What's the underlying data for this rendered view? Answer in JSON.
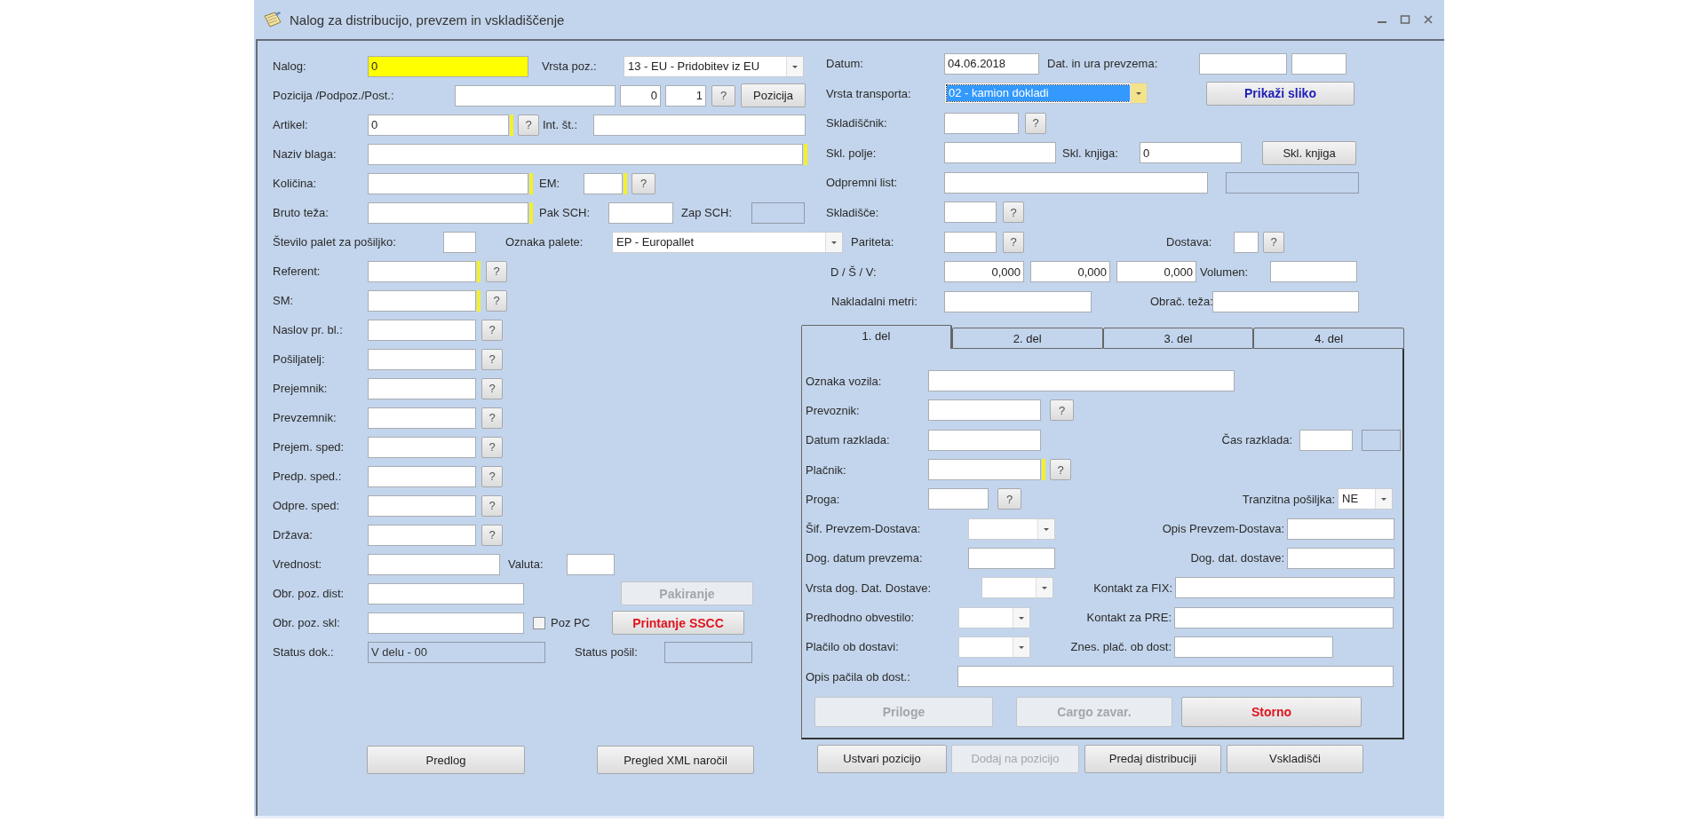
{
  "window": {
    "title": "Nalog za distribucijo, prevzem in vskladiščenje"
  },
  "left": {
    "rows": [
      {
        "items": [
          {
            "kind": "label",
            "text": "Nalog:"
          },
          {
            "kind": "field",
            "value": "0",
            "highlight": true
          },
          {
            "kind": "label",
            "text": "Vrsta poz.:"
          },
          {
            "kind": "combo",
            "value": "13 - EU - Pridobitev iz EU",
            "focused": false
          }
        ]
      },
      {
        "items": [
          {
            "kind": "label",
            "text": "Pozicija /Podpoz./Post.:"
          },
          {
            "kind": "field"
          },
          {
            "kind": "field",
            "value": "0"
          },
          {
            "kind": "field",
            "value": "1"
          },
          {
            "kind": "help",
            "text": "?"
          },
          {
            "kind": "button",
            "label": "Pozicija",
            "bold": false,
            "disabled": false
          }
        ]
      },
      {
        "items": [
          {
            "kind": "label",
            "text": "Artikel:"
          },
          {
            "kind": "field",
            "value": "0",
            "required": true
          },
          {
            "kind": "help",
            "text": "?"
          },
          {
            "kind": "label",
            "text": "Int. št.:"
          },
          {
            "kind": "field"
          }
        ]
      },
      {
        "items": [
          {
            "kind": "label",
            "text": "Naziv blaga:"
          },
          {
            "kind": "field",
            "required": true
          }
        ]
      },
      {
        "items": [
          {
            "kind": "label",
            "text": "Količina:"
          },
          {
            "kind": "field",
            "required": true
          },
          {
            "kind": "label",
            "text": "EM:"
          },
          {
            "kind": "field",
            "required": true
          },
          {
            "kind": "help",
            "text": "?"
          }
        ]
      },
      {
        "items": [
          {
            "kind": "label",
            "text": "Bruto teža:"
          },
          {
            "kind": "field",
            "required": true
          },
          {
            "kind": "label",
            "text": "Pak SCH:"
          },
          {
            "kind": "field"
          },
          {
            "kind": "label",
            "text": "Zap SCH:"
          },
          {
            "kind": "field",
            "disabled": true
          }
        ]
      },
      {
        "items": [
          {
            "kind": "label",
            "text": "Število palet za pošiljko:"
          },
          {
            "kind": "field"
          },
          {
            "kind": "label",
            "text": "Oznaka palete:"
          },
          {
            "kind": "combo",
            "value": "EP - Europallet",
            "focused": false
          }
        ]
      },
      {
        "items": [
          {
            "kind": "label",
            "text": "Referent:"
          },
          {
            "kind": "field",
            "required": true
          },
          {
            "kind": "help",
            "text": "?"
          }
        ]
      },
      {
        "items": [
          {
            "kind": "label",
            "text": "SM:"
          },
          {
            "kind": "field",
            "required": true
          },
          {
            "kind": "help",
            "text": "?"
          }
        ]
      },
      {
        "items": [
          {
            "kind": "label",
            "text": "Naslov pr. bl.:"
          },
          {
            "kind": "field"
          },
          {
            "kind": "help",
            "text": "?"
          }
        ]
      },
      {
        "items": [
          {
            "kind": "label",
            "text": "Pošiljatelj:"
          },
          {
            "kind": "field"
          },
          {
            "kind": "help",
            "text": "?"
          }
        ]
      },
      {
        "items": [
          {
            "kind": "label",
            "text": "Prejemnik:"
          },
          {
            "kind": "field"
          },
          {
            "kind": "help",
            "text": "?"
          }
        ]
      },
      {
        "items": [
          {
            "kind": "label",
            "text": "Prevzemnik:"
          },
          {
            "kind": "field"
          },
          {
            "kind": "help",
            "text": "?"
          }
        ]
      },
      {
        "items": [
          {
            "kind": "label",
            "text": "Prejem. sped:"
          },
          {
            "kind": "field"
          },
          {
            "kind": "help",
            "text": "?"
          }
        ]
      },
      {
        "items": [
          {
            "kind": "label",
            "text": "Predp. sped.:"
          },
          {
            "kind": "field"
          },
          {
            "kind": "help",
            "text": "?"
          }
        ]
      },
      {
        "items": [
          {
            "kind": "label",
            "text": "Odpre. sped:"
          },
          {
            "kind": "field"
          },
          {
            "kind": "help",
            "text": "?"
          }
        ]
      },
      {
        "items": [
          {
            "kind": "label",
            "text": "Država:"
          },
          {
            "kind": "field"
          },
          {
            "kind": "help",
            "text": "?"
          }
        ]
      },
      {
        "items": [
          {
            "kind": "label",
            "text": "Vrednost:"
          },
          {
            "kind": "field"
          },
          {
            "kind": "label",
            "text": "Valuta:"
          },
          {
            "kind": "field"
          }
        ]
      },
      {
        "items": [
          {
            "kind": "label",
            "text": "Obr. poz. dist:"
          },
          {
            "kind": "field"
          },
          {
            "kind": "button",
            "label": "Pakiranje",
            "bold": true,
            "disabled": true
          }
        ]
      },
      {
        "items": [
          {
            "kind": "label",
            "text": "Obr. poz. skl:"
          },
          {
            "kind": "field"
          },
          {
            "kind": "check",
            "label": "Poz PC",
            "checked": false
          },
          {
            "kind": "button",
            "label": "Printanje SSCC",
            "bold": true,
            "danger": true,
            "disabled": false
          }
        ]
      },
      {
        "items": [
          {
            "kind": "label",
            "text": "Status dok.:"
          },
          {
            "kind": "field",
            "value": "V delu - 00",
            "disabled": true
          },
          {
            "kind": "label",
            "text": "Status pošil:"
          },
          {
            "kind": "field",
            "disabled": true
          }
        ]
      }
    ],
    "buttons": [
      {
        "label": "Predlog",
        "bold": false,
        "disabled": false
      },
      {
        "label": "Pregled XML naročil",
        "bold": false,
        "disabled": false
      }
    ]
  },
  "right": {
    "rows": [
      {
        "items": [
          {
            "kind": "label",
            "text": "Datum:"
          },
          {
            "kind": "field",
            "value": "04.06.2018"
          },
          {
            "kind": "label",
            "text": "Dat. in ura prevzema:"
          },
          {
            "kind": "field"
          },
          {
            "kind": "field"
          }
        ]
      },
      {
        "items": [
          {
            "kind": "label",
            "text": "Vrsta transporta:"
          },
          {
            "kind": "combo",
            "value": "02 - kamion dokladi",
            "focused": true
          },
          {
            "kind": "button",
            "label": "Prikaži sliko",
            "bold": true,
            "accent": true,
            "disabled": false
          }
        ]
      },
      {
        "items": [
          {
            "kind": "label",
            "text": "Skladiščnik:"
          },
          {
            "kind": "field"
          },
          {
            "kind": "help",
            "text": "?"
          }
        ]
      },
      {
        "items": [
          {
            "kind": "label",
            "text": "Skl. polje:"
          },
          {
            "kind": "field"
          },
          {
            "kind": "label",
            "text": "Skl. knjiga:"
          },
          {
            "kind": "field",
            "value": "0"
          },
          {
            "kind": "button",
            "label": "Skl. knjiga",
            "bold": false,
            "disabled": false
          }
        ]
      },
      {
        "items": [
          {
            "kind": "label",
            "text": "Odpremni list:"
          },
          {
            "kind": "field"
          },
          {
            "kind": "field",
            "disabled": true
          }
        ]
      },
      {
        "items": [
          {
            "kind": "label",
            "text": "Skladišče:"
          },
          {
            "kind": "field"
          },
          {
            "kind": "help",
            "text": "?"
          }
        ]
      },
      {
        "items": [
          {
            "kind": "label",
            "text": "Pariteta:"
          },
          {
            "kind": "field"
          },
          {
            "kind": "help",
            "text": "?"
          },
          {
            "kind": "label",
            "text": "Dostava:"
          },
          {
            "kind": "field"
          },
          {
            "kind": "help",
            "text": "?"
          }
        ]
      },
      {
        "items": [
          {
            "kind": "label",
            "text": "D / Š / V:"
          },
          {
            "kind": "field",
            "value": "0,000"
          },
          {
            "kind": "field",
            "value": "0,000"
          },
          {
            "kind": "field",
            "value": "0,000"
          },
          {
            "kind": "label",
            "text": "Volumen:"
          },
          {
            "kind": "field"
          }
        ]
      },
      {
        "items": [
          {
            "kind": "label",
            "text": "Nakladalni metri:"
          },
          {
            "kind": "field"
          },
          {
            "kind": "label",
            "text": "Obrač. teža:"
          },
          {
            "kind": "field"
          }
        ]
      }
    ]
  },
  "tabs": [
    {
      "label": "1. del",
      "selected": true
    },
    {
      "label": "2. del",
      "selected": false
    },
    {
      "label": "3. del",
      "selected": false
    },
    {
      "label": "4. del",
      "selected": false
    }
  ],
  "tab_panel": {
    "rows": [
      {
        "items": [
          {
            "kind": "label",
            "text": "Oznaka vozila:"
          },
          {
            "kind": "field"
          }
        ]
      },
      {
        "items": [
          {
            "kind": "label",
            "text": "Prevoznik:"
          },
          {
            "kind": "field"
          },
          {
            "kind": "help",
            "text": "?"
          }
        ]
      },
      {
        "items": [
          {
            "kind": "label",
            "text": "Datum razklada:"
          },
          {
            "kind": "field"
          },
          {
            "kind": "label",
            "text": "Čas razklada:"
          },
          {
            "kind": "field"
          },
          {
            "kind": "field",
            "disabled": true
          }
        ]
      },
      {
        "items": [
          {
            "kind": "label",
            "text": "Plačnik:"
          },
          {
            "kind": "field",
            "required": true
          },
          {
            "kind": "help",
            "text": "?"
          }
        ]
      },
      {
        "items": [
          {
            "kind": "label",
            "text": "Proga:"
          },
          {
            "kind": "field"
          },
          {
            "kind": "help",
            "text": "?"
          },
          {
            "kind": "label",
            "text": "Tranzitna pošiljka:"
          },
          {
            "kind": "combo",
            "value": "NE",
            "focused": false
          }
        ]
      },
      {
        "items": [
          {
            "kind": "label",
            "text": "Šif. Prevzem-Dostava:"
          },
          {
            "kind": "combo",
            "focused": false
          },
          {
            "kind": "label",
            "text": "Opis Prevzem-Dostava:"
          },
          {
            "kind": "field"
          }
        ]
      },
      {
        "items": [
          {
            "kind": "label",
            "text": "Dog. datum prevzema:"
          },
          {
            "kind": "field"
          },
          {
            "kind": "label",
            "text": "Dog. dat. dostave:"
          },
          {
            "kind": "field"
          }
        ]
      },
      {
        "items": [
          {
            "kind": "label",
            "text": "Vrsta dog. Dat. Dostave:"
          },
          {
            "kind": "combo",
            "focused": false
          },
          {
            "kind": "label",
            "text": "Kontakt za FIX:"
          },
          {
            "kind": "field"
          }
        ]
      },
      {
        "items": [
          {
            "kind": "label",
            "text": "Predhodno obvestilo:"
          },
          {
            "kind": "combo",
            "focused": false
          },
          {
            "kind": "label",
            "text": "Kontakt za PRE:"
          },
          {
            "kind": "field"
          }
        ]
      },
      {
        "items": [
          {
            "kind": "label",
            "text": "Plačilo ob dostavi:"
          },
          {
            "kind": "combo",
            "focused": false
          },
          {
            "kind": "label",
            "text": "Znes. plač. ob dost:"
          },
          {
            "kind": "field"
          }
        ]
      },
      {
        "items": [
          {
            "kind": "label",
            "text": "Opis pačila ob dost.:"
          },
          {
            "kind": "field"
          }
        ]
      }
    ],
    "buttons": [
      {
        "label": "Priloge",
        "bold": true,
        "disabled": true
      },
      {
        "label": "Cargo zavar.",
        "bold": true,
        "disabled": true
      },
      {
        "label": "Storno",
        "bold": true,
        "danger": true,
        "disabled": false
      }
    ]
  },
  "bottom_buttons": [
    {
      "label": "Ustvari pozicijo",
      "bold": false,
      "disabled": false
    },
    {
      "label": "Dodaj na pozicijo",
      "bold": false,
      "disabled": true
    },
    {
      "label": "Predaj distribuciji",
      "bold": false,
      "disabled": false
    },
    {
      "label": "Vskladišči",
      "bold": false,
      "disabled": false
    }
  ]
}
